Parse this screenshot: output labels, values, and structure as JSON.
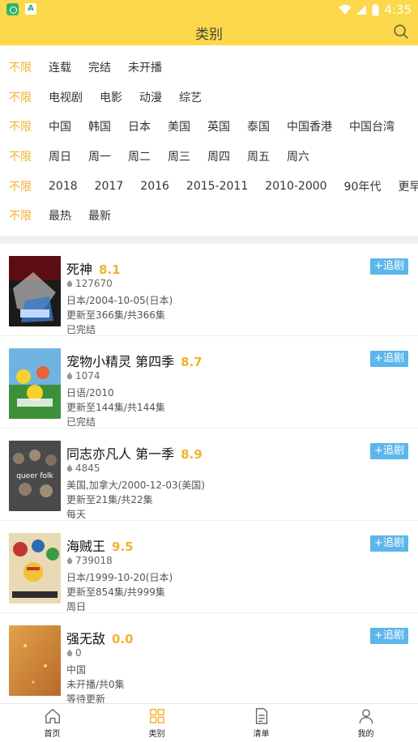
{
  "statusbar": {
    "time": "4:35"
  },
  "appbar": {
    "title": "类别"
  },
  "filters": [
    {
      "first": "不限",
      "options": [
        "连载",
        "完结",
        "未开播"
      ]
    },
    {
      "first": "不限",
      "options": [
        "电视剧",
        "电影",
        "动漫",
        "综艺"
      ]
    },
    {
      "first": "不限",
      "options": [
        "中国",
        "韩国",
        "日本",
        "美国",
        "英国",
        "泰国",
        "中国香港",
        "中国台湾"
      ]
    },
    {
      "first": "不限",
      "options": [
        "周日",
        "周一",
        "周二",
        "周三",
        "周四",
        "周五",
        "周六"
      ]
    },
    {
      "first": "不限",
      "options": [
        "2018",
        "2017",
        "2016",
        "2015-2011",
        "2010-2000",
        "90年代",
        "更早"
      ]
    },
    {
      "first": "不限",
      "options": [
        "最热",
        "最新"
      ]
    }
  ],
  "items": [
    {
      "title": "死神",
      "score": "8.1",
      "hot": "127670",
      "line1": "日本/2004-10-05(日本)",
      "line2": "更新至366集/共366集",
      "line3": "已完结",
      "button": "+追剧"
    },
    {
      "title": "宠物小精灵 第四季",
      "score": "8.7",
      "hot": "1074",
      "line1": "日语/2010",
      "line2": "更新至144集/共144集",
      "line3": "已完结",
      "button": "+追剧"
    },
    {
      "title": "同志亦凡人 第一季",
      "score": "8.9",
      "hot": "4845",
      "line1": "美国,加拿大/2000-12-03(美国)",
      "line2": "更新至21集/共22集",
      "line3": "每天",
      "button": "+追剧",
      "poster_text": "queer folk"
    },
    {
      "title": "海贼王",
      "score": "9.5",
      "hot": "739018",
      "line1": "日本/1999-10-20(日本)",
      "line2": "更新至854集/共999集",
      "line3": "周日",
      "button": "+追剧"
    },
    {
      "title": "强无敌",
      "score": "0.0",
      "hot": "0",
      "line1": "中国",
      "line2": "未开播/共0集",
      "line3": "等待更新",
      "button": "+追剧"
    }
  ],
  "nav": [
    {
      "label": "首页",
      "icon": "home-icon"
    },
    {
      "label": "类别",
      "icon": "grid-icon"
    },
    {
      "label": "清单",
      "icon": "list-icon"
    },
    {
      "label": "我的",
      "icon": "person-icon"
    }
  ],
  "colors": {
    "accent": "#fdd84a",
    "active_filter": "#f3b22f",
    "follow_button": "#5cb6ec"
  }
}
